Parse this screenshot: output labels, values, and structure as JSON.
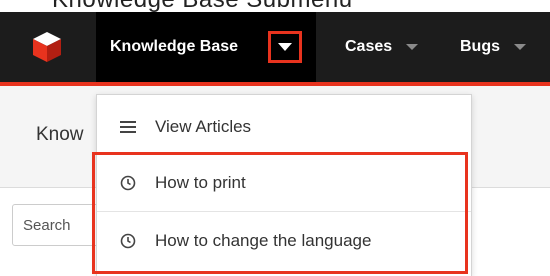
{
  "top_caption": "Knowledge Base Submenu",
  "navbar": {
    "items": [
      {
        "label": "Knowledge Base"
      },
      {
        "label": "Cases"
      },
      {
        "label": "Bugs"
      }
    ]
  },
  "page": {
    "title": "Know",
    "search_placeholder": "Search"
  },
  "dropdown": {
    "items": [
      {
        "label": "View Articles",
        "icon": "list-icon"
      },
      {
        "label": "How to print",
        "icon": "clock-icon"
      },
      {
        "label": "How to change the language",
        "icon": "clock-icon"
      }
    ]
  },
  "colors": {
    "navbar": "#1c1c1c",
    "accent": "#e8331e",
    "highlight": "#e8331e"
  }
}
